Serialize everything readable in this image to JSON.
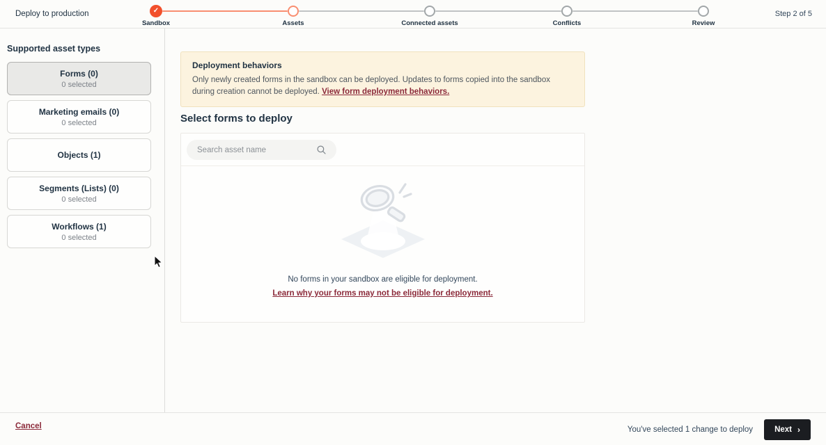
{
  "header": {
    "title": "Deploy to production",
    "step_indicator": "Step 2 of 5",
    "steps": [
      {
        "label": "Sandbox",
        "state": "completed"
      },
      {
        "label": "Assets",
        "state": "current"
      },
      {
        "label": "Connected assets",
        "state": "upcoming"
      },
      {
        "label": "Conflicts",
        "state": "upcoming"
      },
      {
        "label": "Review",
        "state": "upcoming"
      }
    ]
  },
  "sidebar": {
    "heading": "Supported asset types",
    "asset_types": [
      {
        "label": "Forms (0)",
        "sublabel": "0 selected",
        "selected": true
      },
      {
        "label": "Marketing emails (0)",
        "sublabel": "0 selected",
        "selected": false
      },
      {
        "label": "Objects (1)",
        "sublabel": "",
        "selected": false
      },
      {
        "label": "Segments (Lists) (0)",
        "sublabel": "0 selected",
        "selected": false
      },
      {
        "label": "Workflows (1)",
        "sublabel": "0 selected",
        "selected": false
      }
    ]
  },
  "main": {
    "callout": {
      "title": "Deployment behaviors",
      "body": "Only newly created forms in the sandbox can be deployed. Updates to forms copied into the sandbox during creation cannot be deployed. ",
      "link": "View form deployment behaviors."
    },
    "section_title": "Select forms to deploy",
    "search": {
      "placeholder": "Search asset name"
    },
    "empty_state": {
      "message": "No forms in your sandbox are eligible for deployment.",
      "link": "Learn why your forms may not be eligible for deployment."
    }
  },
  "footer": {
    "cancel_label": "Cancel",
    "selection_summary": "You've selected 1 change to deploy",
    "next_label": "Next"
  },
  "icons": {
    "completed_check": "✓",
    "next_chevron": "›"
  },
  "colors": {
    "accent_orange": "#f2502c",
    "accent_orange_light": "#f98e70",
    "link_maroon": "#8b2939",
    "callout_bg": "#fcf3df",
    "next_button_bg": "#1b1d21"
  }
}
